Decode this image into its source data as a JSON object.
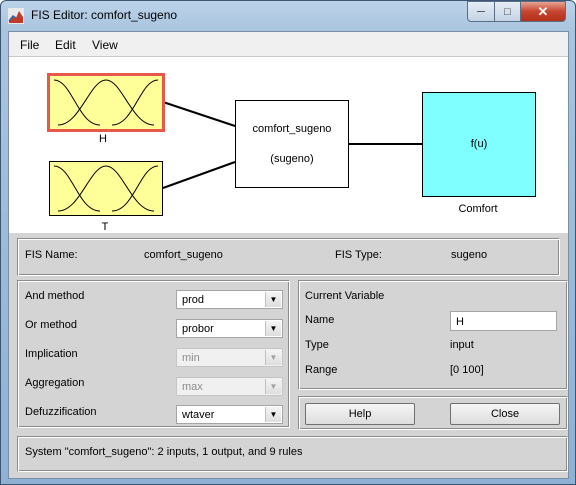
{
  "window": {
    "title": "FIS Editor: comfort_sugeno",
    "controls": {
      "minimize": "─",
      "maximize": "□",
      "close": "✕"
    }
  },
  "menu": [
    "File",
    "Edit",
    "View"
  ],
  "diagram": {
    "inputs": [
      {
        "label": "H",
        "selected": true
      },
      {
        "label": "T",
        "selected": false
      }
    ],
    "system": {
      "name": "comfort_sugeno",
      "type": "(sugeno)"
    },
    "output": {
      "function": "f(u)",
      "label": "Comfort"
    },
    "colors": {
      "input_fill": "#ffff99",
      "selected_border": "#e8584a",
      "output_fill": "#7fffff"
    }
  },
  "fis_info": {
    "name_label": "FIS Name:",
    "name_value": "comfort_sugeno",
    "type_label": "FIS Type:",
    "type_value": "sugeno"
  },
  "methods": [
    {
      "label": "And method",
      "value": "prod",
      "enabled": true
    },
    {
      "label": "Or method",
      "value": "probor",
      "enabled": true
    },
    {
      "label": "Implication",
      "value": "min",
      "enabled": false
    },
    {
      "label": "Aggregation",
      "value": "max",
      "enabled": false
    },
    {
      "label": "Defuzzification",
      "value": "wtaver",
      "enabled": true
    }
  ],
  "current_variable": {
    "heading": "Current Variable",
    "name_label": "Name",
    "name_value": "H",
    "type_label": "Type",
    "type_value": "input",
    "range_label": "Range",
    "range_value": "[0 100]"
  },
  "buttons": {
    "help": "Help",
    "close": "Close"
  },
  "status": "System \"comfort_sugeno\": 2 inputs, 1 output, and 9 rules"
}
